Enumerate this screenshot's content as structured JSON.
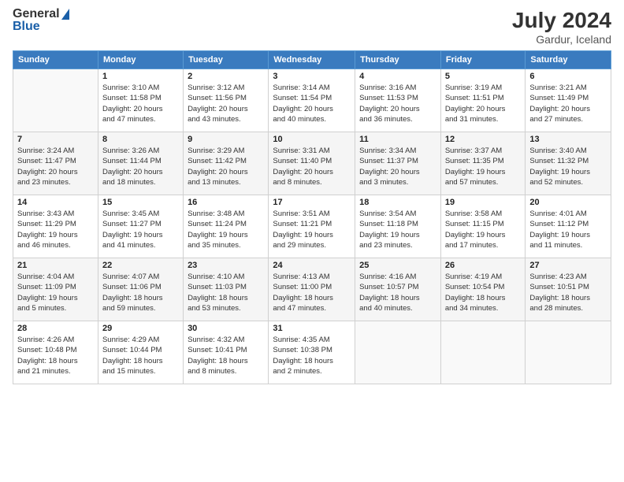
{
  "logo": {
    "text_general": "General",
    "text_blue": "Blue"
  },
  "header": {
    "month_year": "July 2024",
    "location": "Gardur, Iceland"
  },
  "weekdays": [
    "Sunday",
    "Monday",
    "Tuesday",
    "Wednesday",
    "Thursday",
    "Friday",
    "Saturday"
  ],
  "weeks": [
    [
      {
        "day": "",
        "info": ""
      },
      {
        "day": "1",
        "info": "Sunrise: 3:10 AM\nSunset: 11:58 PM\nDaylight: 20 hours\nand 47 minutes."
      },
      {
        "day": "2",
        "info": "Sunrise: 3:12 AM\nSunset: 11:56 PM\nDaylight: 20 hours\nand 43 minutes."
      },
      {
        "day": "3",
        "info": "Sunrise: 3:14 AM\nSunset: 11:54 PM\nDaylight: 20 hours\nand 40 minutes."
      },
      {
        "day": "4",
        "info": "Sunrise: 3:16 AM\nSunset: 11:53 PM\nDaylight: 20 hours\nand 36 minutes."
      },
      {
        "day": "5",
        "info": "Sunrise: 3:19 AM\nSunset: 11:51 PM\nDaylight: 20 hours\nand 31 minutes."
      },
      {
        "day": "6",
        "info": "Sunrise: 3:21 AM\nSunset: 11:49 PM\nDaylight: 20 hours\nand 27 minutes."
      }
    ],
    [
      {
        "day": "7",
        "info": "Sunrise: 3:24 AM\nSunset: 11:47 PM\nDaylight: 20 hours\nand 23 minutes."
      },
      {
        "day": "8",
        "info": "Sunrise: 3:26 AM\nSunset: 11:44 PM\nDaylight: 20 hours\nand 18 minutes."
      },
      {
        "day": "9",
        "info": "Sunrise: 3:29 AM\nSunset: 11:42 PM\nDaylight: 20 hours\nand 13 minutes."
      },
      {
        "day": "10",
        "info": "Sunrise: 3:31 AM\nSunset: 11:40 PM\nDaylight: 20 hours\nand 8 minutes."
      },
      {
        "day": "11",
        "info": "Sunrise: 3:34 AM\nSunset: 11:37 PM\nDaylight: 20 hours\nand 3 minutes."
      },
      {
        "day": "12",
        "info": "Sunrise: 3:37 AM\nSunset: 11:35 PM\nDaylight: 19 hours\nand 57 minutes."
      },
      {
        "day": "13",
        "info": "Sunrise: 3:40 AM\nSunset: 11:32 PM\nDaylight: 19 hours\nand 52 minutes."
      }
    ],
    [
      {
        "day": "14",
        "info": "Sunrise: 3:43 AM\nSunset: 11:29 PM\nDaylight: 19 hours\nand 46 minutes."
      },
      {
        "day": "15",
        "info": "Sunrise: 3:45 AM\nSunset: 11:27 PM\nDaylight: 19 hours\nand 41 minutes."
      },
      {
        "day": "16",
        "info": "Sunrise: 3:48 AM\nSunset: 11:24 PM\nDaylight: 19 hours\nand 35 minutes."
      },
      {
        "day": "17",
        "info": "Sunrise: 3:51 AM\nSunset: 11:21 PM\nDaylight: 19 hours\nand 29 minutes."
      },
      {
        "day": "18",
        "info": "Sunrise: 3:54 AM\nSunset: 11:18 PM\nDaylight: 19 hours\nand 23 minutes."
      },
      {
        "day": "19",
        "info": "Sunrise: 3:58 AM\nSunset: 11:15 PM\nDaylight: 19 hours\nand 17 minutes."
      },
      {
        "day": "20",
        "info": "Sunrise: 4:01 AM\nSunset: 11:12 PM\nDaylight: 19 hours\nand 11 minutes."
      }
    ],
    [
      {
        "day": "21",
        "info": "Sunrise: 4:04 AM\nSunset: 11:09 PM\nDaylight: 19 hours\nand 5 minutes."
      },
      {
        "day": "22",
        "info": "Sunrise: 4:07 AM\nSunset: 11:06 PM\nDaylight: 18 hours\nand 59 minutes."
      },
      {
        "day": "23",
        "info": "Sunrise: 4:10 AM\nSunset: 11:03 PM\nDaylight: 18 hours\nand 53 minutes."
      },
      {
        "day": "24",
        "info": "Sunrise: 4:13 AM\nSunset: 11:00 PM\nDaylight: 18 hours\nand 47 minutes."
      },
      {
        "day": "25",
        "info": "Sunrise: 4:16 AM\nSunset: 10:57 PM\nDaylight: 18 hours\nand 40 minutes."
      },
      {
        "day": "26",
        "info": "Sunrise: 4:19 AM\nSunset: 10:54 PM\nDaylight: 18 hours\nand 34 minutes."
      },
      {
        "day": "27",
        "info": "Sunrise: 4:23 AM\nSunset: 10:51 PM\nDaylight: 18 hours\nand 28 minutes."
      }
    ],
    [
      {
        "day": "28",
        "info": "Sunrise: 4:26 AM\nSunset: 10:48 PM\nDaylight: 18 hours\nand 21 minutes."
      },
      {
        "day": "29",
        "info": "Sunrise: 4:29 AM\nSunset: 10:44 PM\nDaylight: 18 hours\nand 15 minutes."
      },
      {
        "day": "30",
        "info": "Sunrise: 4:32 AM\nSunset: 10:41 PM\nDaylight: 18 hours\nand 8 minutes."
      },
      {
        "day": "31",
        "info": "Sunrise: 4:35 AM\nSunset: 10:38 PM\nDaylight: 18 hours\nand 2 minutes."
      },
      {
        "day": "",
        "info": ""
      },
      {
        "day": "",
        "info": ""
      },
      {
        "day": "",
        "info": ""
      }
    ]
  ]
}
